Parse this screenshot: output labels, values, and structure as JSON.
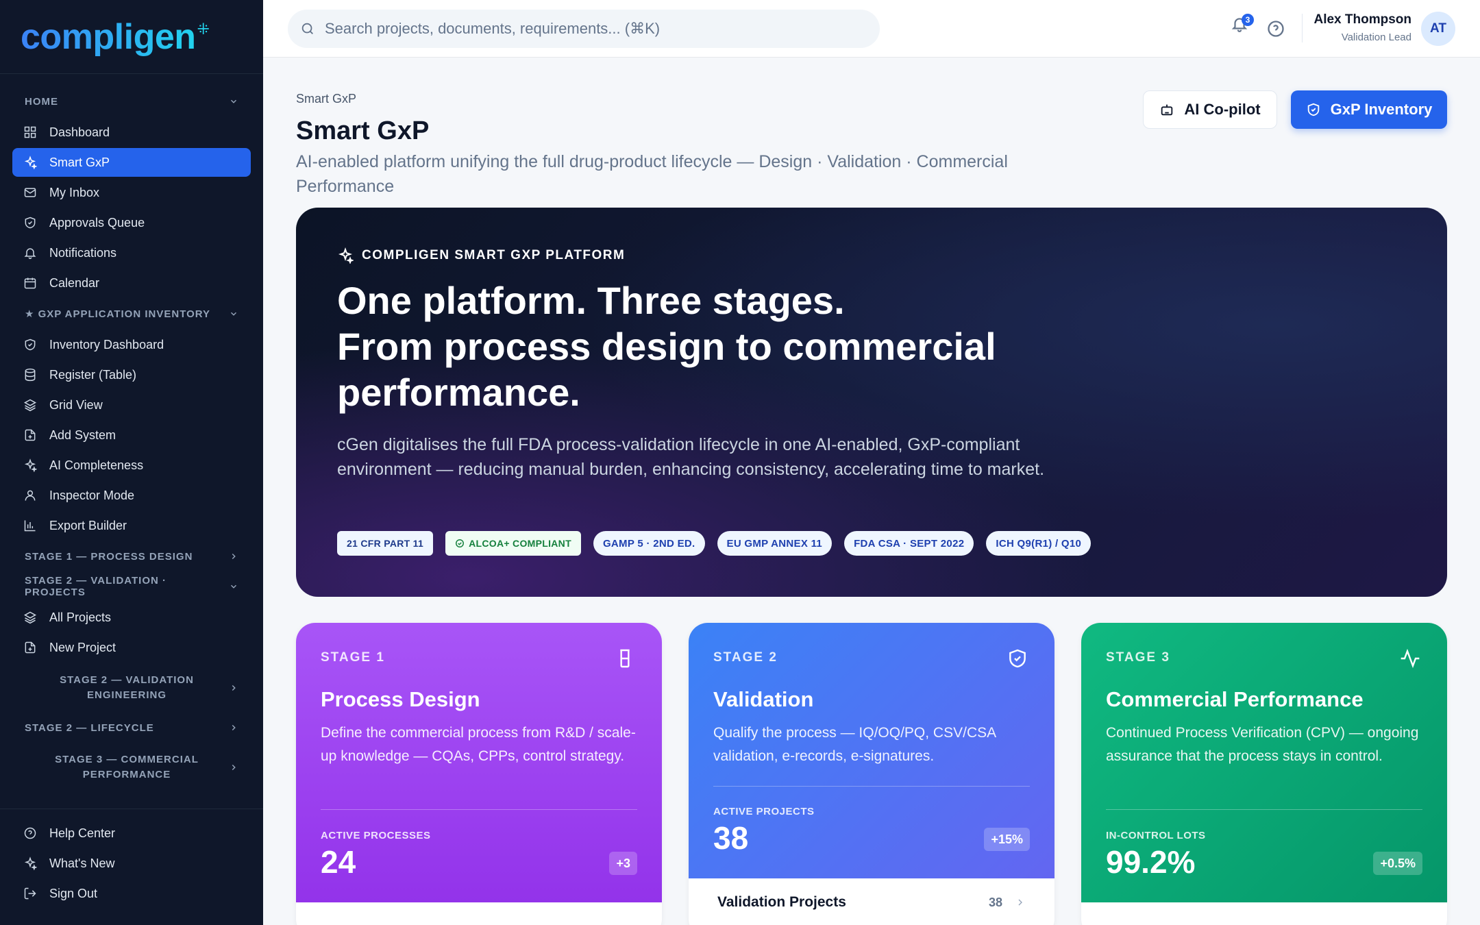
{
  "brand": {
    "name": "compligen"
  },
  "sidebar": {
    "home_section": "HOME",
    "home_items": [
      {
        "label": "Dashboard",
        "icon": "grid-icon"
      },
      {
        "label": "Smart GxP",
        "icon": "sparkles-icon",
        "active": true
      },
      {
        "label": "My Inbox",
        "icon": "inbox-icon"
      },
      {
        "label": "Approvals Queue",
        "icon": "shield-check-icon"
      },
      {
        "label": "Notifications",
        "icon": "bell-icon"
      },
      {
        "label": "Calendar",
        "icon": "calendar-icon"
      }
    ],
    "inventory_section": "★ GXP APPLICATION INVENTORY",
    "inventory_items": [
      {
        "label": "Inventory Dashboard",
        "icon": "shield-check-icon"
      },
      {
        "label": "Register (Table)",
        "icon": "database-icon"
      },
      {
        "label": "Grid View",
        "icon": "layers-icon"
      },
      {
        "label": "Add System",
        "icon": "file-plus-icon"
      },
      {
        "label": "AI Completeness",
        "icon": "sparkles-icon"
      },
      {
        "label": "Inspector Mode",
        "icon": "user-icon"
      },
      {
        "label": "Export Builder",
        "icon": "bar-chart-icon"
      }
    ],
    "stage1_section": "STAGE 1 — PROCESS DESIGN",
    "stage2_section": "STAGE 2 — VALIDATION · PROJECTS",
    "stage2_items": [
      {
        "label": "All Projects",
        "icon": "layers-icon"
      },
      {
        "label": "New Project",
        "icon": "file-plus-icon"
      }
    ],
    "stage2_engineering_section": "STAGE 2 — VALIDATION ENGINEERING",
    "stage2_lifecycle_section": "STAGE 2 — LIFECYCLE",
    "stage3_section": "STAGE 3 — COMMERCIAL PERFORMANCE",
    "bottom_items": [
      {
        "label": "Help Center",
        "icon": "help-circle-icon"
      },
      {
        "label": "What's New",
        "icon": "sparkles-icon"
      },
      {
        "label": "Sign Out",
        "icon": "log-out-icon"
      }
    ]
  },
  "topbar": {
    "search_placeholder": "Search projects, documents, requirements... (⌘K)",
    "notification_count": "3",
    "user_name": "Alex Thompson",
    "user_role": "Validation Lead",
    "user_initials": "AT"
  },
  "page": {
    "breadcrumb": "Smart GxP",
    "title": "Smart GxP",
    "subtitle": "AI-enabled platform unifying the full drug-product lifecycle — Design · Validation · Commercial Performance",
    "copilot_label": "AI Co-pilot",
    "inventory_label": "GxP Inventory"
  },
  "hero": {
    "eyebrow": "COMPLIGEN SMART GXP PLATFORM",
    "headline_lines": [
      "One platform. Three stages.",
      "From process design to commercial",
      "performance."
    ],
    "body": "cGen digitalises the full FDA process-validation lifecycle in one AI-enabled, GxP-compliant environment — reducing manual burden, enhancing consistency, accelerating time to market.",
    "chips": [
      "21 CFR PART 11",
      "ALCOA+ COMPLIANT",
      "GAMP 5 · 2ND ED.",
      "EU GMP ANNEX 11",
      "FDA CSA · SEPT 2022",
      "ICH Q9(R1) / Q10"
    ]
  },
  "stages": [
    {
      "label": "STAGE 1",
      "title": "Process Design",
      "icon": "beaker-icon",
      "description": "Define the commercial process from R&D / scale-up knowledge — CQAs, CPPs, control strategy.",
      "metric_label": "ACTIVE PROCESSES",
      "metric_value": "24",
      "delta": "+3"
    },
    {
      "label": "STAGE 2",
      "title": "Validation",
      "icon": "shield-check-icon",
      "description": "Qualify the process — IQ/OQ/PQ, CSV/CSA validation, e-records, e-signatures.",
      "metric_label": "ACTIVE PROJECTS",
      "metric_value": "38",
      "delta": "+15%",
      "row_label": "Validation Projects",
      "row_count": "38"
    },
    {
      "label": "STAGE 3",
      "title": "Commercial Performance",
      "icon": "activity-icon",
      "description": "Continued Process Verification (CPV) — ongoing assurance that the process stays in control.",
      "metric_label": "IN-CONTROL LOTS",
      "metric_value": "99.2%",
      "delta": "+0.5%"
    }
  ],
  "colors": {
    "sidebar_bg": "#0f172a",
    "accent": "#2563eb",
    "stage1": "#a855f7",
    "stage2": "#4f75f5",
    "stage3": "#10b981"
  }
}
